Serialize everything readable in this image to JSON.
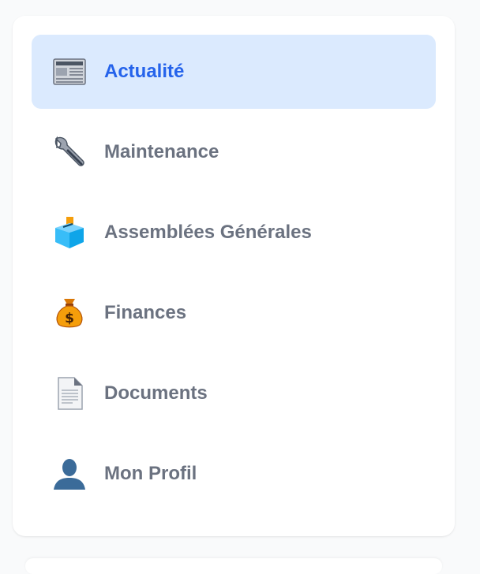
{
  "nav": {
    "items": [
      {
        "label": "Actualité",
        "icon": "newspaper-icon",
        "active": true
      },
      {
        "label": "Maintenance",
        "icon": "wrench-icon",
        "active": false
      },
      {
        "label": "Assemblées Générales",
        "icon": "ballot-box-icon",
        "active": false
      },
      {
        "label": "Finances",
        "icon": "money-bag-icon",
        "active": false
      },
      {
        "label": "Documents",
        "icon": "document-icon",
        "active": false
      },
      {
        "label": "Mon Profil",
        "icon": "user-icon",
        "active": false
      }
    ]
  },
  "colors": {
    "active_bg": "#dbeafe",
    "active_text": "#2563eb",
    "inactive_text": "#6b7280"
  }
}
